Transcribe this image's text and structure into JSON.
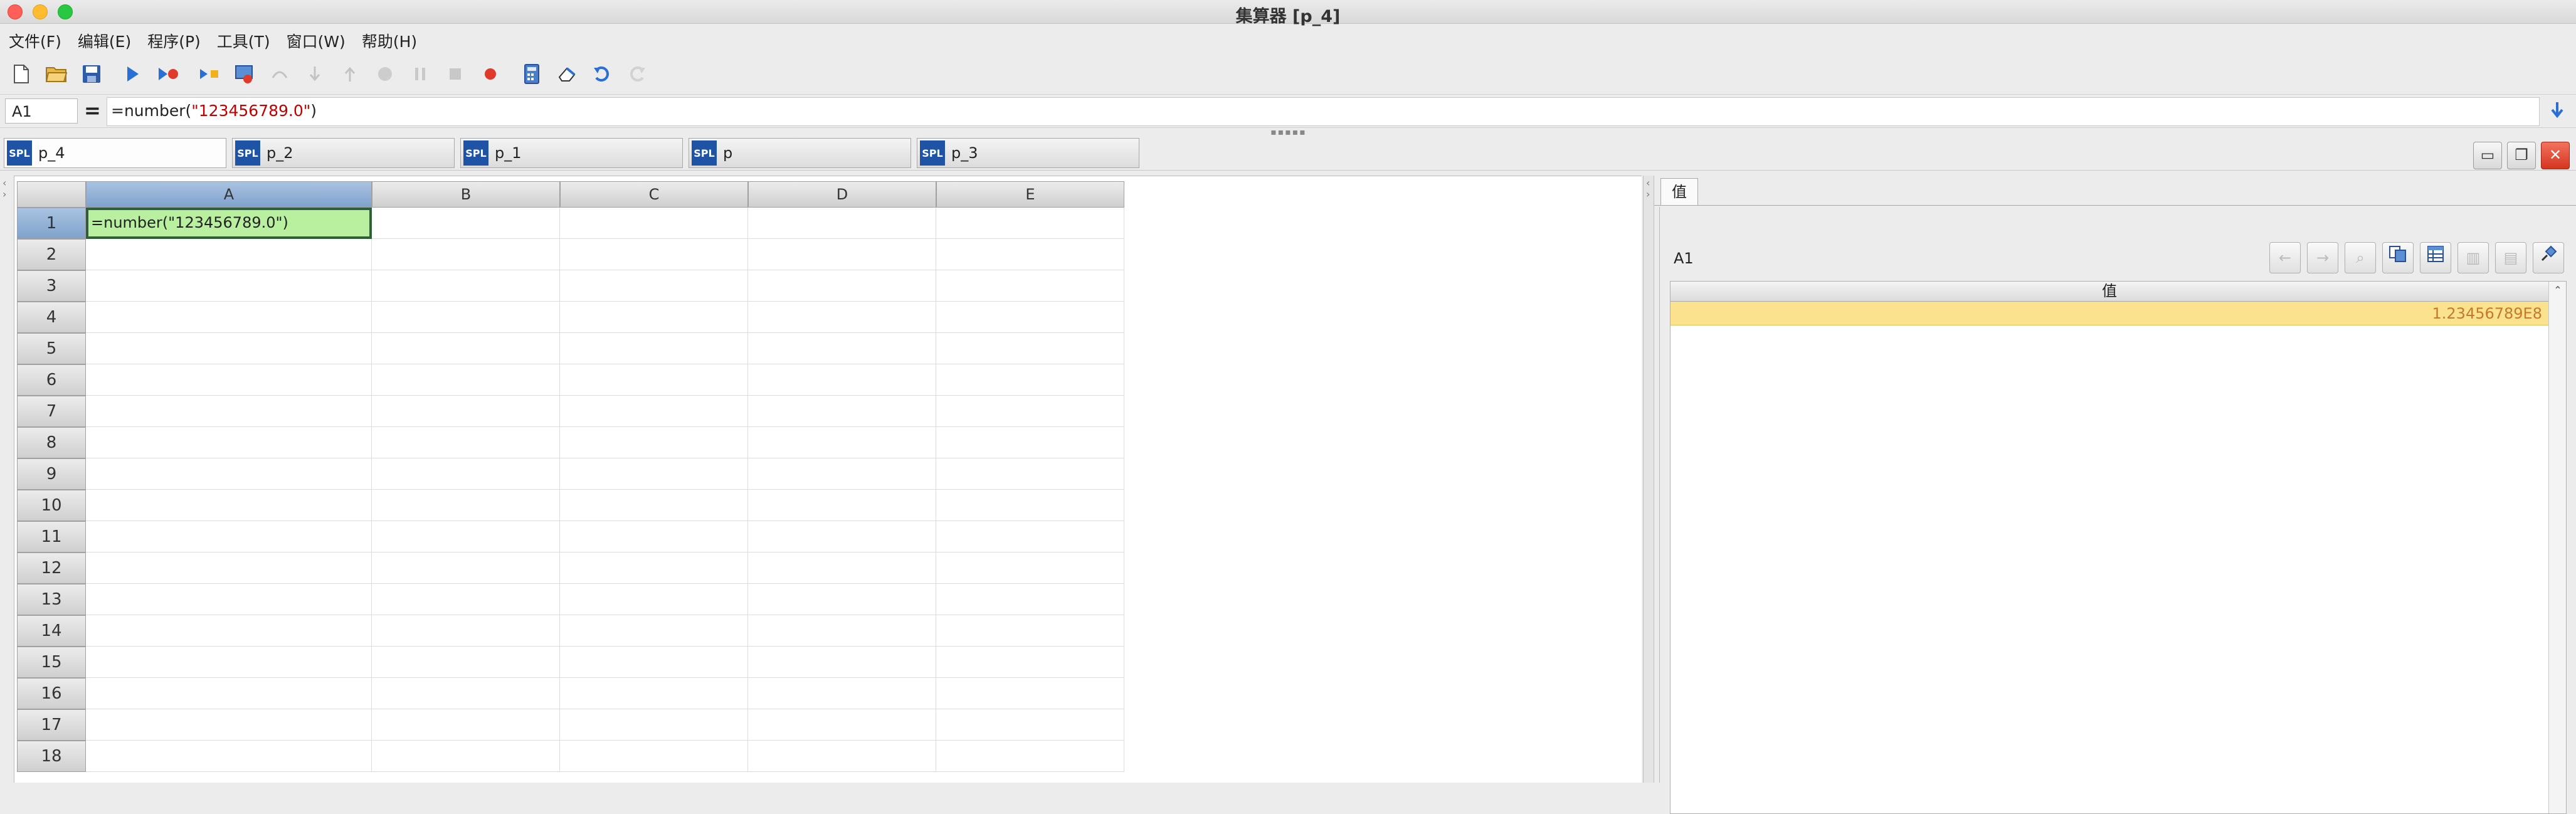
{
  "window": {
    "title": "集算器 [p_4]"
  },
  "menu": [
    "文件(F)",
    "编辑(E)",
    "程序(P)",
    "工具(T)",
    "窗口(W)",
    "帮助(H)"
  ],
  "toolbar_icons": [
    "new-file",
    "open-folder",
    "save",
    "run",
    "debug",
    "step",
    "run-to-cursor",
    "step-over",
    "step-into",
    "step-out",
    "stop-cycle",
    "pause",
    "stop",
    "breakpoint",
    "calculator",
    "clear",
    "undo",
    "redo"
  ],
  "formula_bar": {
    "cell_ref": "A1",
    "equals": "=",
    "formula_prefix": "=number(",
    "formula_string": "\"123456789.0\"",
    "formula_suffix": ")"
  },
  "tabs": [
    {
      "badge": "SPL",
      "label": "p_4",
      "active": true
    },
    {
      "badge": "SPL",
      "label": "p_2",
      "active": false
    },
    {
      "badge": "SPL",
      "label": "p_1",
      "active": false
    },
    {
      "badge": "SPL",
      "label": "p",
      "active": false
    },
    {
      "badge": "SPL",
      "label": "p_3",
      "active": false
    }
  ],
  "grid": {
    "columns": [
      "A",
      "B",
      "C",
      "D",
      "E"
    ],
    "rows": [
      "1",
      "2",
      "3",
      "4",
      "5",
      "6",
      "7",
      "8",
      "9",
      "10",
      "11",
      "12",
      "13",
      "14",
      "15",
      "16",
      "17",
      "18"
    ],
    "selected_cell": "A1",
    "cells": {
      "A1": "=number(\"123456789.0\")"
    }
  },
  "value_panel": {
    "tab_label": "值",
    "cell_ref": "A1",
    "column_header": "值",
    "value": "1.23456789E8"
  },
  "colors": {
    "active_cell_bg": "#b8f0a0",
    "selected_header_bg": "#7fa2cc",
    "value_row_bg": "#fbe28f",
    "value_text": "#c8782a",
    "spl_badge": "#1f53a6"
  }
}
